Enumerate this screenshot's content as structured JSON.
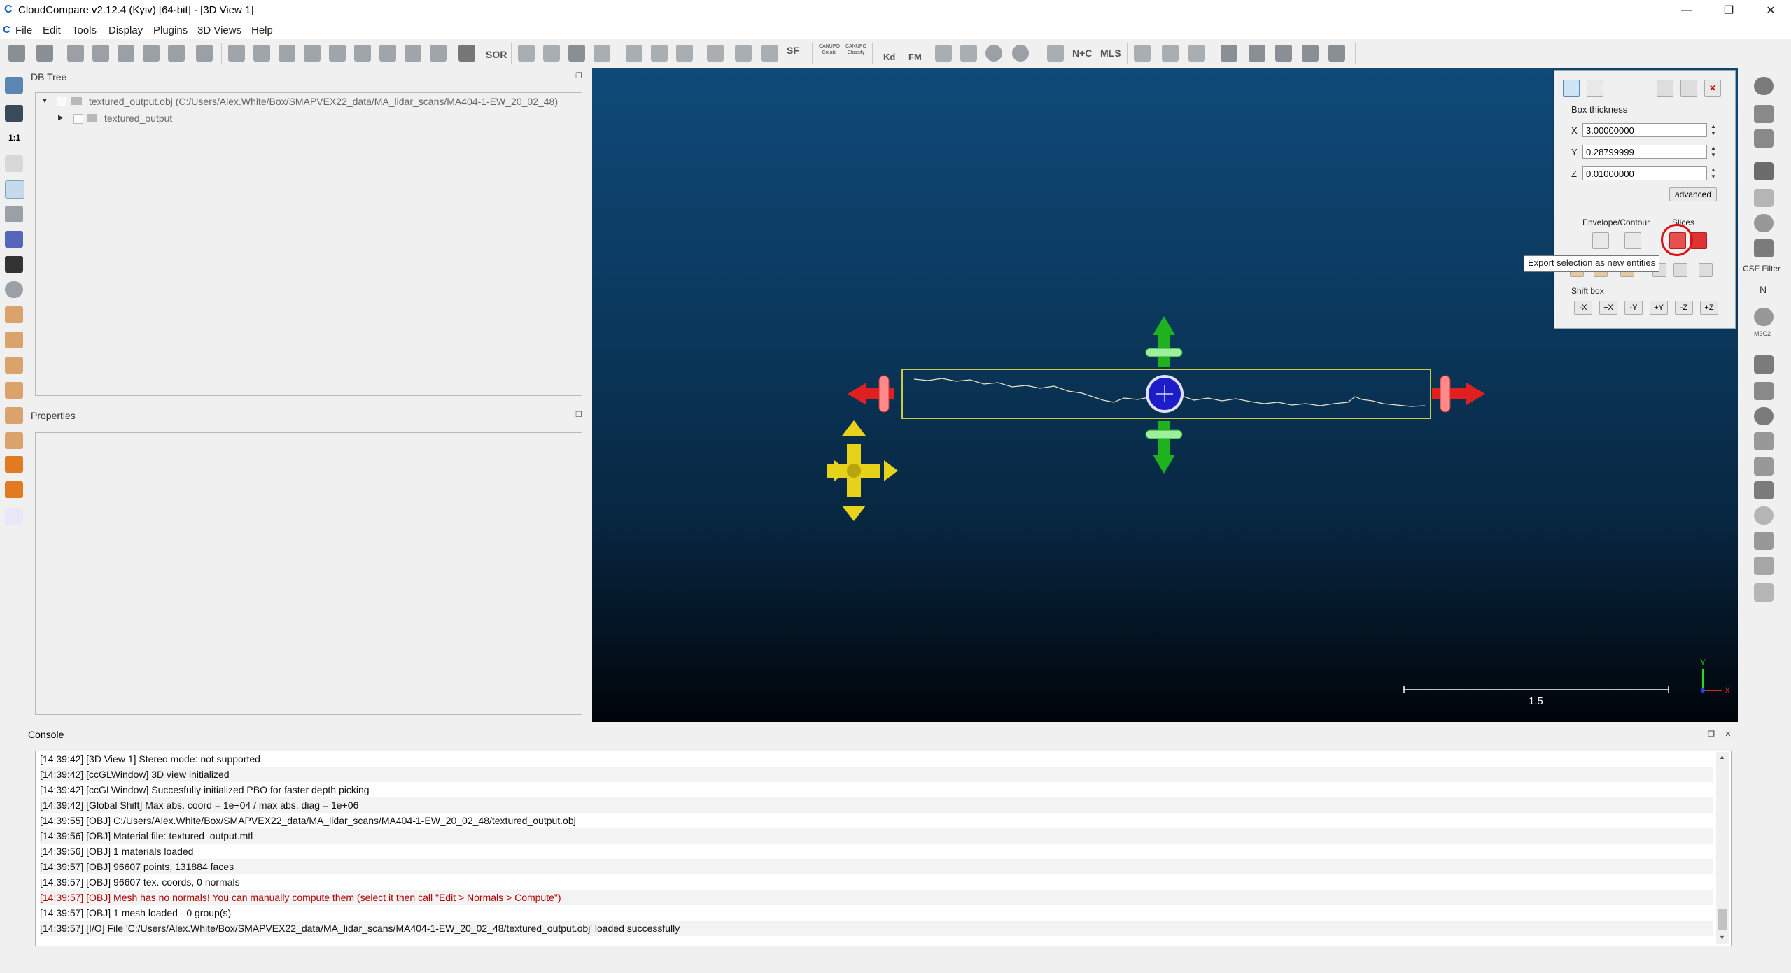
{
  "window": {
    "title": "CloudCompare v2.12.4 (Kyiv) [64-bit] - [3D View 1]",
    "controls": [
      "—",
      "❐",
      "✕"
    ]
  },
  "menubar": [
    "File",
    "Edit",
    "Tools",
    "Display",
    "Plugins",
    "3D Views",
    "Help"
  ],
  "toolbar": {
    "text_icons": {
      "sor": "SOR",
      "sf": "SF",
      "canupo_create": "CANUPO Create",
      "canupo_classify": "CANUPO Classify",
      "kd": "Kd",
      "fm": "FM",
      "nc": "N+C",
      "mls": "MLS",
      "one_to_one": "1:1"
    }
  },
  "db_tree": {
    "title": "DB Tree",
    "root": "textured_output.obj (C:/Users/Alex.White/Box/SMAPVEX22_data/MA_lidar_scans/MA404-1-EW_20_02_48)",
    "child": "textured_output"
  },
  "properties": {
    "title": "Properties"
  },
  "section_panel": {
    "box_thickness_label": "Box thickness",
    "x_label": "X",
    "x_value": "3.00000000",
    "y_label": "Y",
    "y_value": "0.28799999",
    "z_label": "Z",
    "z_value": "0.01000000",
    "advanced_label": "advanced",
    "envelope_label": "Envelope/Contour",
    "slices_label": "Slices",
    "shift_box_label": "Shift box",
    "shift_buttons": [
      "-X",
      "+X",
      "-Y",
      "+Y",
      "-Z",
      "+Z"
    ]
  },
  "tooltip": "Export selection as new entities",
  "right_toolbar": {
    "csf_label": "CSF Filter",
    "n_label": "N",
    "m3c2_label": "M3C2"
  },
  "view3d": {
    "scale_label": "1.5",
    "axis_y": "Y",
    "axis_x": "X"
  },
  "console": {
    "title": "Console",
    "lines": [
      "[14:39:42] [3D View 1] Stereo mode: not supported",
      "[14:39:42] [ccGLWindow] 3D view initialized",
      "[14:39:42] [ccGLWindow] Succesfully initialized PBO for faster depth picking",
      "[14:39:42] [Global Shift] Max abs. coord = 1e+04 / max abs. diag = 1e+06",
      "[14:39:55] [OBJ] C:/Users/Alex.White/Box/SMAPVEX22_data/MA_lidar_scans/MA404-1-EW_20_02_48/textured_output.obj",
      "[14:39:56] [OBJ] Material file: textured_output.mtl",
      "[14:39:56] [OBJ] 1 materials loaded",
      "[14:39:57] [OBJ] 96607 points, 131884 faces",
      "[14:39:57] [OBJ] 96607 tex. coords, 0 normals",
      "[14:39:57] [OBJ] Mesh has no normals! You can manually compute them (select it then call \"Edit > Normals > Compute\")",
      "[14:39:57] [OBJ] 1 mesh loaded - 0 group(s)",
      "[14:39:57] [I/O] File 'C:/Users/Alex.White/Box/SMAPVEX22_data/MA_lidar_scans/MA404-1-EW_20_02_48/textured_output.obj' loaded successfully"
    ],
    "error_line_index": 9
  },
  "colors": {
    "view_top": "#0f4a78",
    "view_bottom": "#010409",
    "arrow_red": "#e02020",
    "arrow_green": "#1fb21f",
    "arrow_yellow": "#e6d21a",
    "center_blue": "#1c1cc8",
    "box_outline": "#c8c84a",
    "highlight_red": "#e01010"
  }
}
